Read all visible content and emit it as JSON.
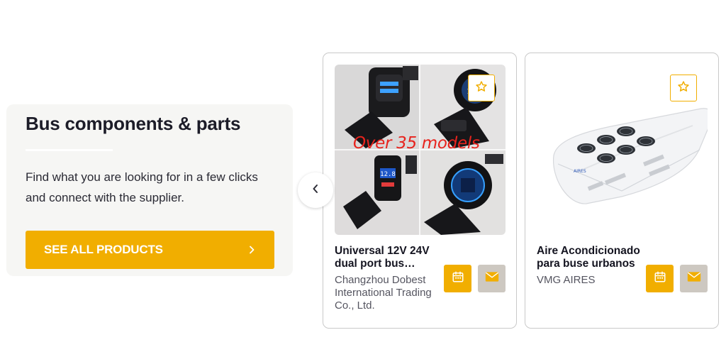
{
  "intro": {
    "title": "Bus components & parts",
    "description": "Find what you are looking for in a few clicks and connect with the supplier.",
    "cta_label": "SEE ALL PRODUCTS"
  },
  "carousel": {
    "prev_icon": "chevron-left-icon"
  },
  "products": [
    {
      "title": "Universal 12V 24V dual port bus…",
      "supplier": "Changzhou Dobest International Trading Co., Ltd.",
      "image_overlay_text": "Over 35 models",
      "image_inset_readout": "12.8"
    },
    {
      "title": "Aire Acondicionado para buse urbanos",
      "supplier": "VMG AIRES",
      "image_brand_text": "AIRES"
    }
  ],
  "colors": {
    "accent": "#f1ae00",
    "mail_button": "#cdc8c1",
    "panel_bg": "#f6f6f4",
    "overlay_red": "#e8231d"
  }
}
